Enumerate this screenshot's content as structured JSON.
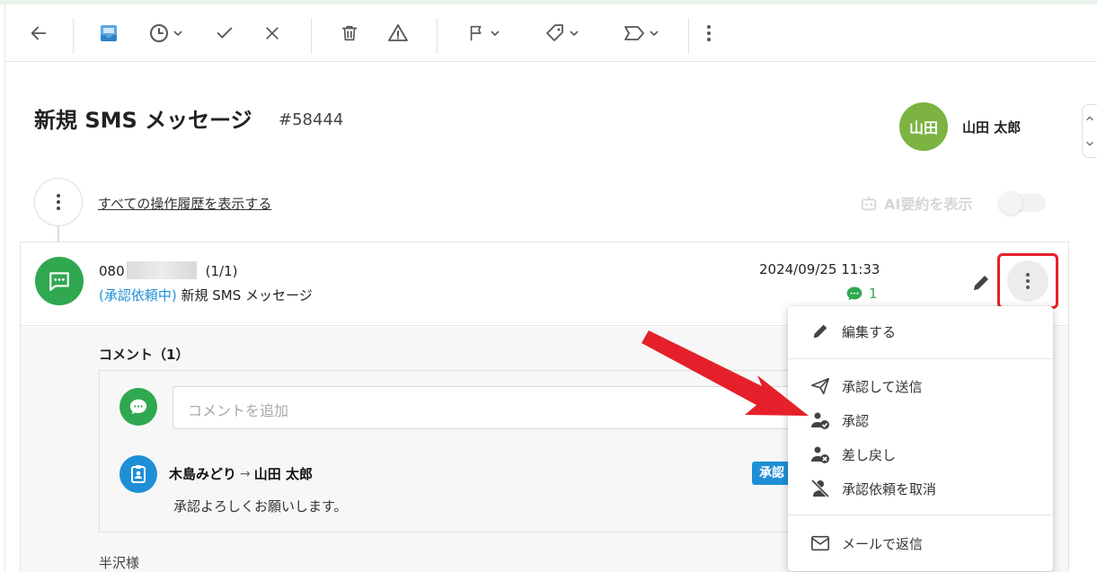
{
  "toolbar": {
    "items": [
      "back-arrow-icon",
      "inbox-icon",
      "clock-icon",
      "check-icon",
      "close-icon",
      "trash-icon",
      "warning-icon",
      "flag-icon",
      "tag-icon",
      "label-icon",
      "more-vertical-icon"
    ]
  },
  "header": {
    "title": "新規 SMS メッセージ",
    "ticket_id": "#58444",
    "assignee_initials": "山田",
    "assignee_name": "山田 太郎"
  },
  "history": {
    "link_label": "すべての操作履歴を表示する",
    "ai_summary_label": "AI要約を表示"
  },
  "message": {
    "phone_prefix": "080",
    "page_count": "(1/1)",
    "status": "(承認依頼中)",
    "subject": "新規 SMS メッセージ",
    "date": "2024/09/25 11:33",
    "comment_count": "1"
  },
  "comments": {
    "title": "コメント（1）",
    "input_placeholder": "コメントを追加",
    "entry": {
      "from": "木島みどり",
      "arrow": "→",
      "to": "山田 太郎",
      "badge": "承認",
      "text": "承認よろしくお願いします。"
    }
  },
  "body_preview": "半沢様",
  "context_menu": {
    "items": [
      {
        "label": "編集する",
        "icon": "pencil-icon"
      },
      {
        "label": "承認して送信",
        "icon": "send-icon"
      },
      {
        "label": "承認",
        "icon": "user-check-icon"
      },
      {
        "label": "差し戻し",
        "icon": "user-x-icon"
      },
      {
        "label": "承認依頼を取消",
        "icon": "user-slash-icon"
      },
      {
        "label": "メールで返信",
        "icon": "mail-icon"
      }
    ]
  },
  "colors": {
    "accent_green": "#2fa84f",
    "link_blue": "#1e8fd6",
    "avatar_green": "#7cb342",
    "highlight_red": "#e5202a"
  }
}
